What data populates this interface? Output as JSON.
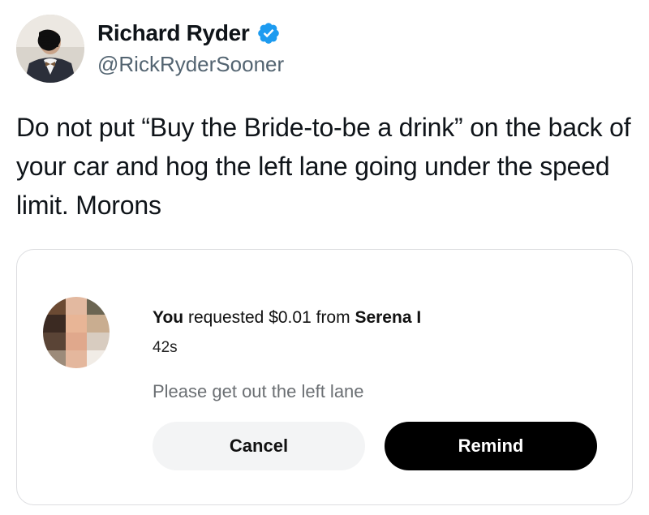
{
  "tweet": {
    "author": {
      "name": "Richard Ryder",
      "handle": "@RickRyderSooner",
      "verified": true,
      "verified_color": "#1d9bf0"
    },
    "text": "Do not put “Buy the Bride-to-be a drink” on the back of your car and hog the left lane going under the speed limit. Morons"
  },
  "payment_card": {
    "subject": "You",
    "action": "requested",
    "amount": "$0.01",
    "preposition": "from",
    "recipient": "Serena I",
    "time": "42s",
    "note": "Please get out the left lane",
    "buttons": {
      "cancel_label": "Cancel",
      "remind_label": "Remind"
    }
  }
}
